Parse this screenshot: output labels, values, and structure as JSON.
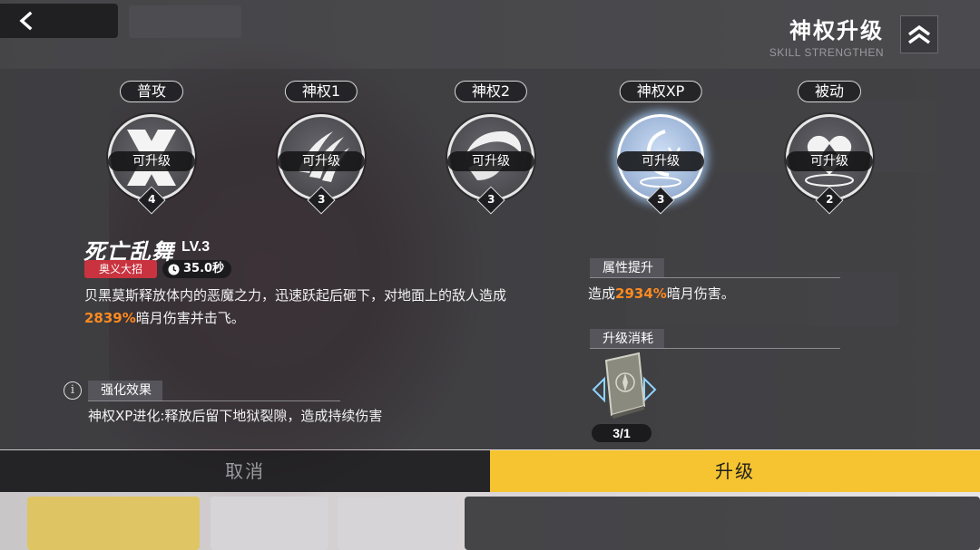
{
  "header": {
    "title": "神权升级",
    "subtitle": "SKILL STRENGTHEN"
  },
  "skills": [
    {
      "tab": "普攻",
      "status": "可升级",
      "level": "4",
      "icon": "cross-slash-icon"
    },
    {
      "tab": "神权1",
      "status": "可升级",
      "level": "3",
      "icon": "claw-slash-icon"
    },
    {
      "tab": "神权2",
      "status": "可升级",
      "level": "3",
      "icon": "crescent-swirl-icon"
    },
    {
      "tab": "神权XP",
      "status": "可升级",
      "level": "3",
      "icon": "moon-glyph-icon",
      "selected": true
    },
    {
      "tab": "被动",
      "status": "可升级",
      "level": "2",
      "icon": "heart-arrow-icon"
    }
  ],
  "detail": {
    "name": "死亡乱舞",
    "level": "LV.3",
    "tag": "奥义大招",
    "cooldown": "35.0秒",
    "desc_part1": "贝黑莫斯释放体内的恶魔之力，迅速跃起后砸下，对地面上的敌人造成",
    "desc_value": "2839%",
    "desc_part2": "暗月伤害并击飞。",
    "enhance_label": "强化效果",
    "enhance_text": "神权XP进化:释放后留下地狱裂隙，造成持续伤害",
    "info_symbol": "i"
  },
  "upgrade": {
    "attr_label": "属性提升",
    "attr_prefix": "造成",
    "attr_value": "2934%",
    "attr_suffix": "暗月伤害。",
    "cost_label": "升级消耗",
    "cost_item": "skill-book-icon",
    "cost_count": "3/1"
  },
  "actions": {
    "cancel": "取消",
    "confirm": "升级"
  },
  "colors": {
    "accent": "#f5c430",
    "highlight": "#ff8a1f",
    "tag_red": "#c8333f"
  }
}
